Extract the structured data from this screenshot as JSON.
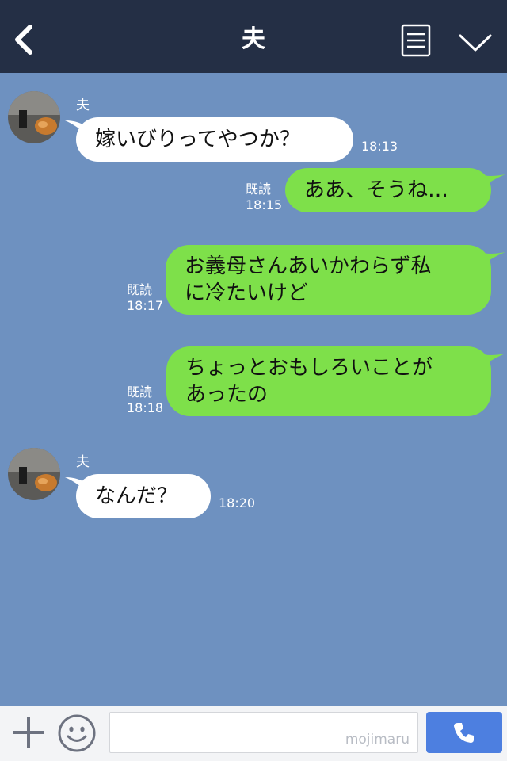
{
  "header": {
    "title": "夫"
  },
  "messages": [
    {
      "sender": "夫",
      "text": "嫁いびりってやつか？",
      "time": "18:13"
    },
    {
      "read": "既読",
      "time": "18:15",
      "text": "ああ、そうね…"
    },
    {
      "read": "既読",
      "time": "18:17",
      "lines": [
        "お義母さんあいかわらず私",
        "に冷たいけど"
      ]
    },
    {
      "read": "既読",
      "time": "18:18",
      "lines": [
        "ちょっとおもしろいことが",
        "あったの"
      ]
    },
    {
      "sender": "夫",
      "text": "なんだ？",
      "time": "18:20"
    }
  ],
  "footer": {
    "watermark": "mojimaru"
  },
  "colors": {
    "header": "#242f45",
    "background": "#6e91c0",
    "outgoing": "#7ee04a",
    "incoming": "#ffffff",
    "call": "#4d7fe0"
  }
}
